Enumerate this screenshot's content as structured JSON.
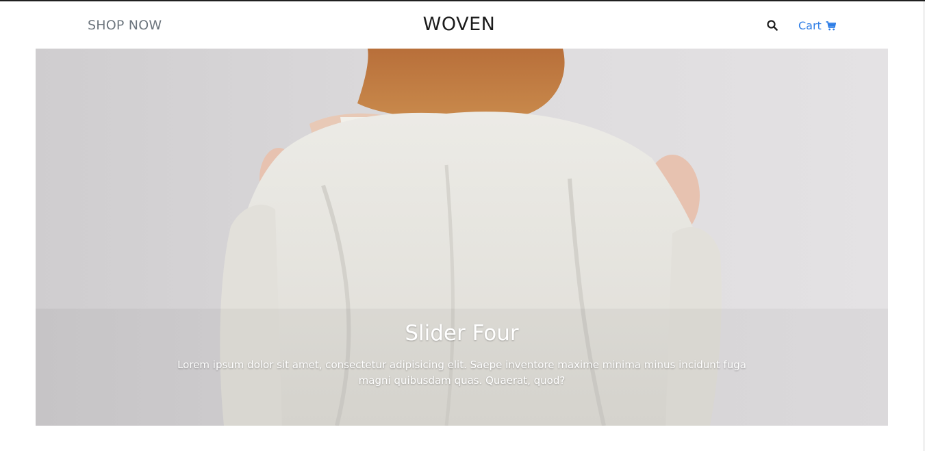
{
  "header": {
    "shop_label": "SHOP NOW",
    "brand": "WOVEN",
    "cart_label": "Cart",
    "search_icon": "search-icon",
    "cart_icon": "cart-icon"
  },
  "slider": {
    "title": "Slider Four",
    "text": "Lorem ipsum dolor sit amet, consectetur adipisicing elit. Saepe inventore maxime minima minus incidunt fuga magni quibusdam quas. Quaerat, quod?"
  },
  "colors": {
    "link_blue": "#2f7ee6",
    "muted_gray": "#6c757d",
    "brand_dark": "#1c1c1c"
  }
}
